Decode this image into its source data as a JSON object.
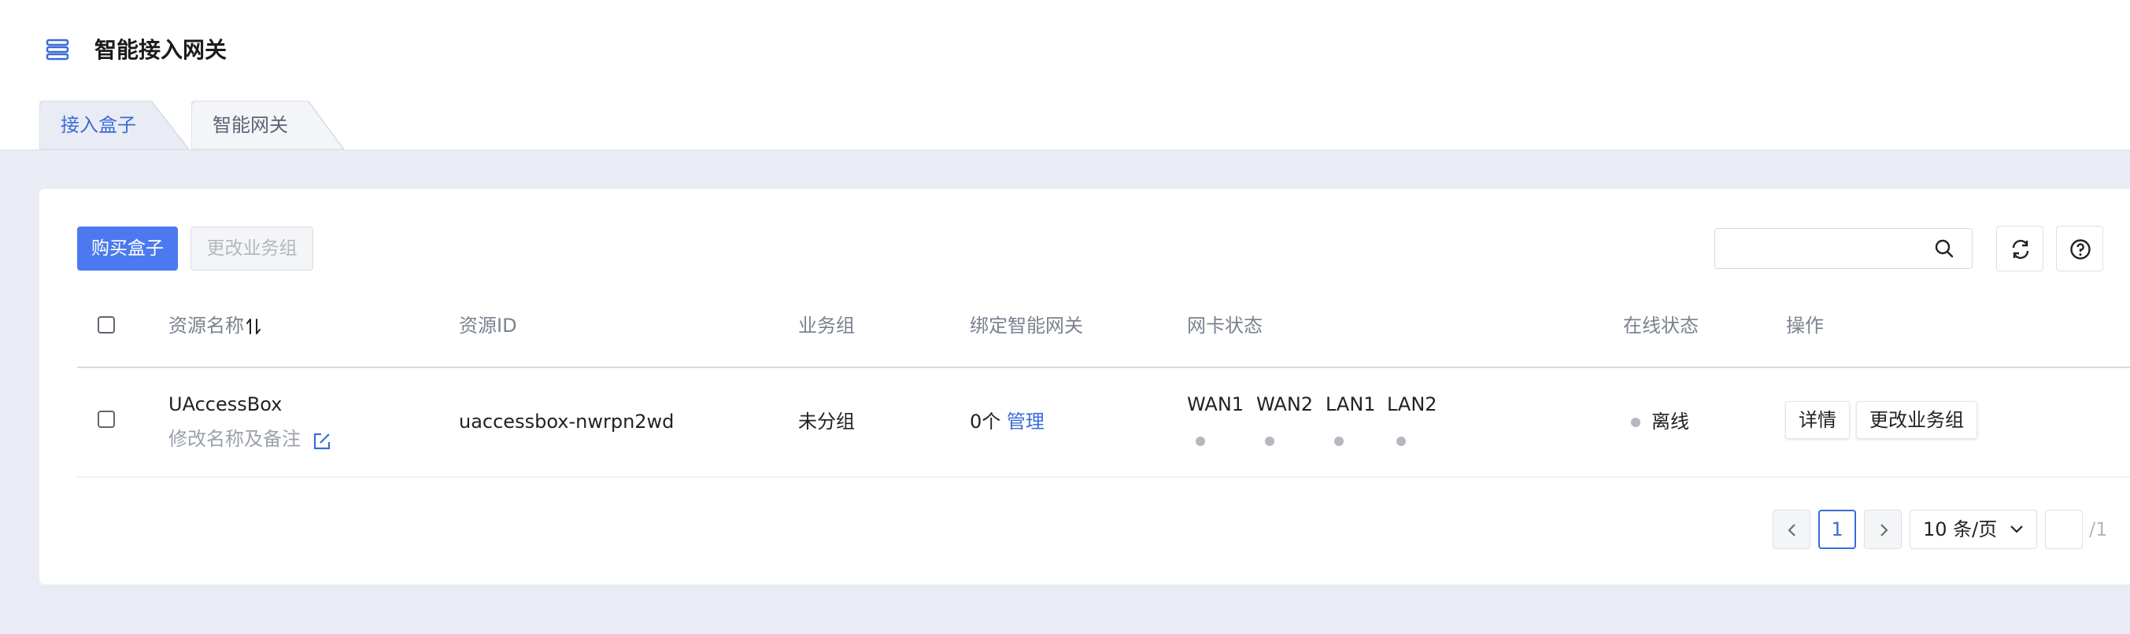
{
  "header": {
    "title": "智能接入网关"
  },
  "tabs": [
    {
      "label": "接入盒子",
      "active": true
    },
    {
      "label": "智能网关",
      "active": false
    }
  ],
  "toolbar": {
    "buy_label": "购买盒子",
    "change_group_label": "更改业务组",
    "search_placeholder": "",
    "refresh_icon": "refresh-icon",
    "help_icon": "help-icon"
  },
  "table": {
    "columns": [
      "资源名称",
      "资源ID",
      "业务组",
      "绑定智能网关",
      "网卡状态",
      "在线状态",
      "操作"
    ],
    "rows": [
      {
        "name": "UAccessBox",
        "edit_hint": "修改名称及备注",
        "id": "uaccessbox-nwrpn2wd",
        "group": "未分组",
        "gateway_count": "0个",
        "gateway_manage": "管理",
        "nics": [
          "WAN1",
          "WAN2",
          "LAN1",
          "LAN2"
        ],
        "online_status": "离线",
        "actions": [
          "详情",
          "更改业务组"
        ]
      }
    ]
  },
  "pagination": {
    "current": "1",
    "page_size": "10 条/页",
    "total": "/1",
    "jump_value": ""
  },
  "colors": {
    "primary": "#4c79f0",
    "link": "#3a6cd8",
    "offline_dot": "#b4b8c0"
  }
}
